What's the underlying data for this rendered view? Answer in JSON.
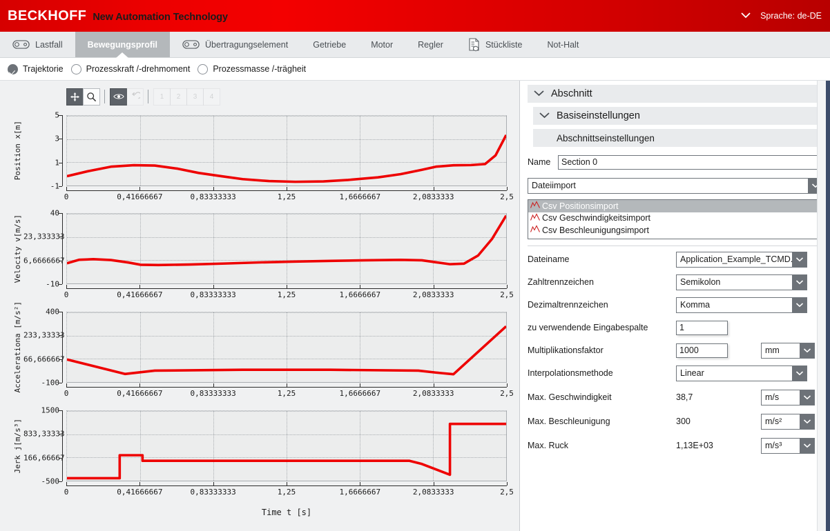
{
  "header": {
    "brand_main": "BECKHOFF",
    "brand_sub": "New Automation Technology",
    "language_label": "Sprache: de-DE",
    "language_chevron_icon": "chevron-down-icon",
    "accent_color": "#e00000"
  },
  "tabs": [
    {
      "label": "Lastfall",
      "icon": "belt-drive-icon",
      "active": false,
      "chevron": false
    },
    {
      "label": "Bewegungsprofil",
      "icon": "",
      "active": true,
      "chevron": true
    },
    {
      "label": "Übertragungselement",
      "icon": "belt-drive-icon",
      "active": false,
      "chevron": true
    },
    {
      "label": "Getriebe",
      "icon": "",
      "active": false,
      "chevron": true
    },
    {
      "label": "Motor",
      "icon": "",
      "active": false,
      "chevron": true
    },
    {
      "label": "Regler",
      "icon": "",
      "active": false,
      "chevron": false
    },
    {
      "label": "Stückliste",
      "icon": "document-3d-icon",
      "active": false,
      "chevron": false
    },
    {
      "label": "Not-Halt",
      "icon": "",
      "active": false,
      "chevron": false
    }
  ],
  "radio_group": {
    "options": [
      {
        "label": "Trajektorie",
        "checked": true
      },
      {
        "label": "Prozesskraft /-drehmoment",
        "checked": false
      },
      {
        "label": "Prozessmasse /-trägheit",
        "checked": false
      }
    ]
  },
  "toolbar": {
    "buttons": [
      {
        "name": "pan-tool-button",
        "icon": "move-arrows-icon",
        "active": true,
        "label": ""
      },
      {
        "name": "zoom-tool-button",
        "icon": "magnifier-icon",
        "active": false,
        "label": ""
      },
      {
        "name": "visibility-toggle-button",
        "icon": "eye-icon",
        "active": true,
        "label": ""
      },
      {
        "name": "undo-button",
        "icon": "undo-arrow-icon",
        "active": false,
        "label": ""
      }
    ],
    "numbered_buttons": [
      {
        "label": "1"
      },
      {
        "label": "2"
      },
      {
        "label": "3"
      },
      {
        "label": "4"
      }
    ]
  },
  "chart_data": [
    {
      "type": "line",
      "name": "position",
      "ylabel": "Position x\n[m]",
      "ylabel_lines": [
        "Position x",
        "[m]"
      ],
      "yticks": [
        "5",
        "3",
        "1",
        "-1"
      ],
      "yvalues": [
        5,
        3,
        1,
        -1
      ],
      "ylim": [
        -1,
        5
      ],
      "xlabel": "",
      "xticks": [
        "0",
        "0,41666667",
        "0,83333333",
        "1,25",
        "1,6666667",
        "2,0833333",
        "2,5"
      ],
      "xvalues": [
        0,
        0.41666667,
        0.83333333,
        1.25,
        1.6666667,
        2.0833333,
        2.5
      ],
      "xlim": [
        0,
        2.5
      ],
      "grid": true,
      "line_color": "#ee0000",
      "x": [
        0,
        0.125,
        0.25,
        0.38,
        0.5,
        0.63,
        0.75,
        0.88,
        1.0,
        1.15,
        1.3,
        1.46,
        1.6,
        1.77,
        1.9,
        2.02,
        2.1,
        2.2,
        2.3,
        2.38,
        2.44,
        2.5
      ],
      "y": [
        -0.2,
        0.25,
        0.62,
        0.75,
        0.72,
        0.45,
        0.08,
        -0.2,
        -0.45,
        -0.62,
        -0.68,
        -0.65,
        -0.52,
        -0.3,
        -0.02,
        0.35,
        0.62,
        0.74,
        0.76,
        0.85,
        1.6,
        3.35
      ]
    },
    {
      "type": "line",
      "name": "velocity",
      "ylabel_lines": [
        "Velocity v",
        "[m/s]"
      ],
      "yticks": [
        "40",
        "23,333333",
        "6,6666667",
        "-10"
      ],
      "yvalues": [
        40,
        23.333333,
        6.6666667,
        -10
      ],
      "ylim": [
        -10,
        40
      ],
      "xticks": [
        "0",
        "0,41666667",
        "0,83333333",
        "1,25",
        "1,6666667",
        "2,0833333",
        "2,5"
      ],
      "xvalues": [
        0,
        0.41666667,
        0.83333333,
        1.25,
        1.6666667,
        2.0833333,
        2.5
      ],
      "xlim": [
        0,
        2.5
      ],
      "grid": true,
      "line_color": "#ee0000",
      "x": [
        0,
        0.07,
        0.15,
        0.25,
        0.35,
        0.42,
        0.52,
        0.7,
        0.9,
        1.1,
        1.3,
        1.5,
        1.7,
        1.9,
        2.02,
        2.1,
        2.18,
        2.26,
        2.34,
        2.42,
        2.5
      ],
      "y": [
        4.5,
        7.0,
        7.4,
        6.8,
        5.0,
        3.4,
        3.2,
        3.6,
        4.3,
        5.1,
        5.7,
        6.2,
        6.6,
        6.9,
        6.6,
        5.2,
        3.8,
        4.2,
        10.0,
        22.0,
        38.7
      ]
    },
    {
      "type": "line",
      "name": "acceleration",
      "ylabel_lines": [
        "Acceleration",
        "a [m/s²]"
      ],
      "yticks": [
        "400",
        "233,33333",
        "66,666667",
        "-100"
      ],
      "yvalues": [
        400,
        233.33333,
        66.666667,
        -100
      ],
      "ylim": [
        -100,
        400
      ],
      "xticks": [
        "0",
        "0,41666667",
        "0,83333333",
        "1,25",
        "1,6666667",
        "2,0833333",
        "2,5"
      ],
      "xvalues": [
        0,
        0.41666667,
        0.83333333,
        1.25,
        1.6666667,
        2.0833333,
        2.5
      ],
      "xlim": [
        0,
        2.5
      ],
      "grid": true,
      "line_color": "#ee0000",
      "x": [
        0,
        0.33,
        0.5,
        1.0,
        1.5,
        2.0,
        2.1,
        2.2,
        2.5
      ],
      "y": [
        62,
        -42,
        -18,
        -12,
        -12,
        -18,
        -32,
        -44,
        300
      ]
    },
    {
      "type": "line",
      "name": "jerk",
      "ylabel_lines": [
        "Jerk j",
        "[m/s³]"
      ],
      "yticks": [
        "1500",
        "833,33333",
        "166,66667",
        "-500"
      ],
      "yvalues": [
        1500,
        833.33333,
        166.66667,
        -500
      ],
      "ylim": [
        -500,
        1500
      ],
      "xticks": [
        "0",
        "0,41666667",
        "0,83333333",
        "1,25",
        "1,6666667",
        "2,0833333",
        "2,5"
      ],
      "xvalues": [
        0,
        0.41666667,
        0.83333333,
        1.25,
        1.6666667,
        2.0833333,
        2.5
      ],
      "xlim": [
        0,
        2.5
      ],
      "grid": true,
      "line_color": "#ee0000",
      "x": [
        0,
        0.3,
        0.3,
        0.43,
        0.43,
        1.95,
        2.02,
        2.18,
        2.18,
        2.5
      ],
      "y": [
        -430,
        -430,
        230,
        230,
        70,
        70,
        -20,
        -330,
        1130,
        1130
      ]
    }
  ],
  "chart_xtitle": "Time t [s]",
  "right_panel": {
    "section_header": "Abschnitt",
    "section_chevron_icon": "chevron-down-icon",
    "base_settings_header": "Basiseinstellungen",
    "base_settings_chevron_icon": "chevron-down-icon",
    "section_settings_header": "Abschnittseinstellungen",
    "name_label": "Name",
    "name_value": "Section 0",
    "mode_combo_value": "Dateiimport",
    "mode_combo_arrow_icon": "chevron-down-icon",
    "import_list": [
      {
        "label": "Csv Positionsimport",
        "selected": true,
        "icon": "curve-icon"
      },
      {
        "label": "Csv Geschwindigkeitsimport",
        "selected": false,
        "icon": "curve-icon"
      },
      {
        "label": "Csv Beschleunigungsimport",
        "selected": false,
        "icon": "curve-icon"
      }
    ],
    "fields": [
      {
        "label": "Dateiname",
        "type": "combo",
        "value": "Application_Example_TCMD.cs",
        "unit": null
      },
      {
        "label": "Zahltrennzeichen",
        "type": "combo",
        "value": "Semikolon",
        "unit": null
      },
      {
        "label": "Dezimaltrennzeichen",
        "type": "combo",
        "value": "Komma",
        "unit": null
      },
      {
        "label": "zu verwendende Eingabespalte",
        "type": "text",
        "value": "1",
        "unit": null
      },
      {
        "label": "Multiplikationsfaktor",
        "type": "text",
        "value": "1000",
        "unit": "mm"
      },
      {
        "label": "Interpolationsmethode",
        "type": "combo",
        "value": "Linear",
        "unit": null
      }
    ],
    "readonly_fields": [
      {
        "label": "Max. Geschwindigkeit",
        "value": "38,7",
        "unit": "m/s"
      },
      {
        "label": "Max. Beschleunigung",
        "value": "300",
        "unit": "m/s²"
      },
      {
        "label": "Max. Ruck",
        "value": "1,13E+03",
        "unit": "m/s³"
      }
    ]
  }
}
